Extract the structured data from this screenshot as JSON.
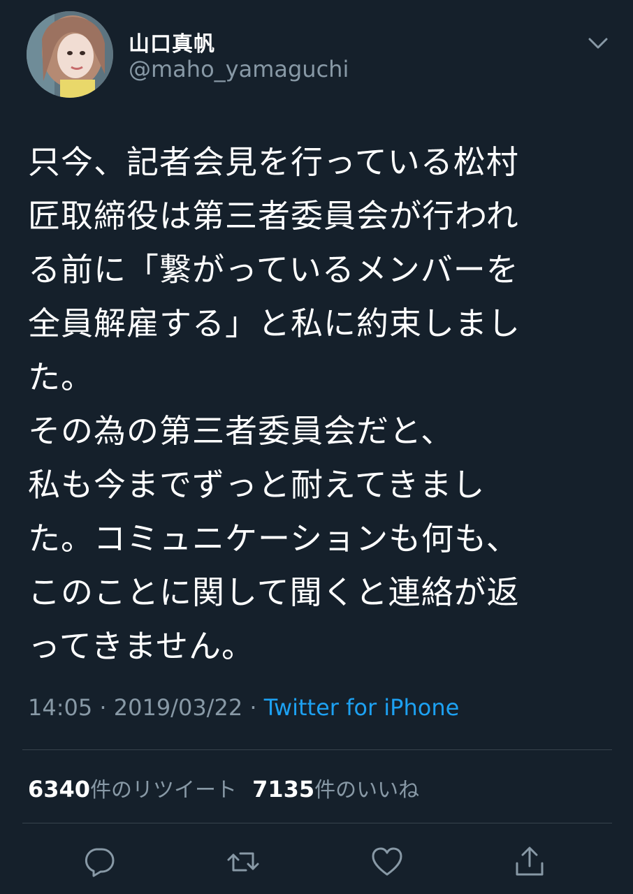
{
  "tweet": {
    "display_name": "山口真帆",
    "username": "@maho_yamaguchi",
    "text": "只今、記者会見を行っている松村\n匠取締役は第三者委員会が行われ\nる前に「繋がっているメンバーを\n全員解雇する」と私に約束しまし\nた。\nその為の第三者委員会だと、\n私も今までずっと耐えてきまし\nた。コミュニケーションも何も、\nこのことに関して聞くと連絡が返\nってきません。",
    "time": "14:05",
    "date": "2019/03/22",
    "separator": "·",
    "source": "Twitter for iPhone"
  },
  "stats": {
    "retweet_count": "6340",
    "retweet_label": "件のリツイート",
    "like_count": "7135",
    "like_label": "件のいいね"
  },
  "icons": {
    "caret": "chevron-down-icon",
    "reply": "reply-icon",
    "retweet": "retweet-icon",
    "like": "heart-icon",
    "share": "share-icon"
  },
  "colors": {
    "background": "#15202b",
    "secondary_text": "#8899a6",
    "link": "#1da1f2",
    "divider": "#38444d"
  }
}
